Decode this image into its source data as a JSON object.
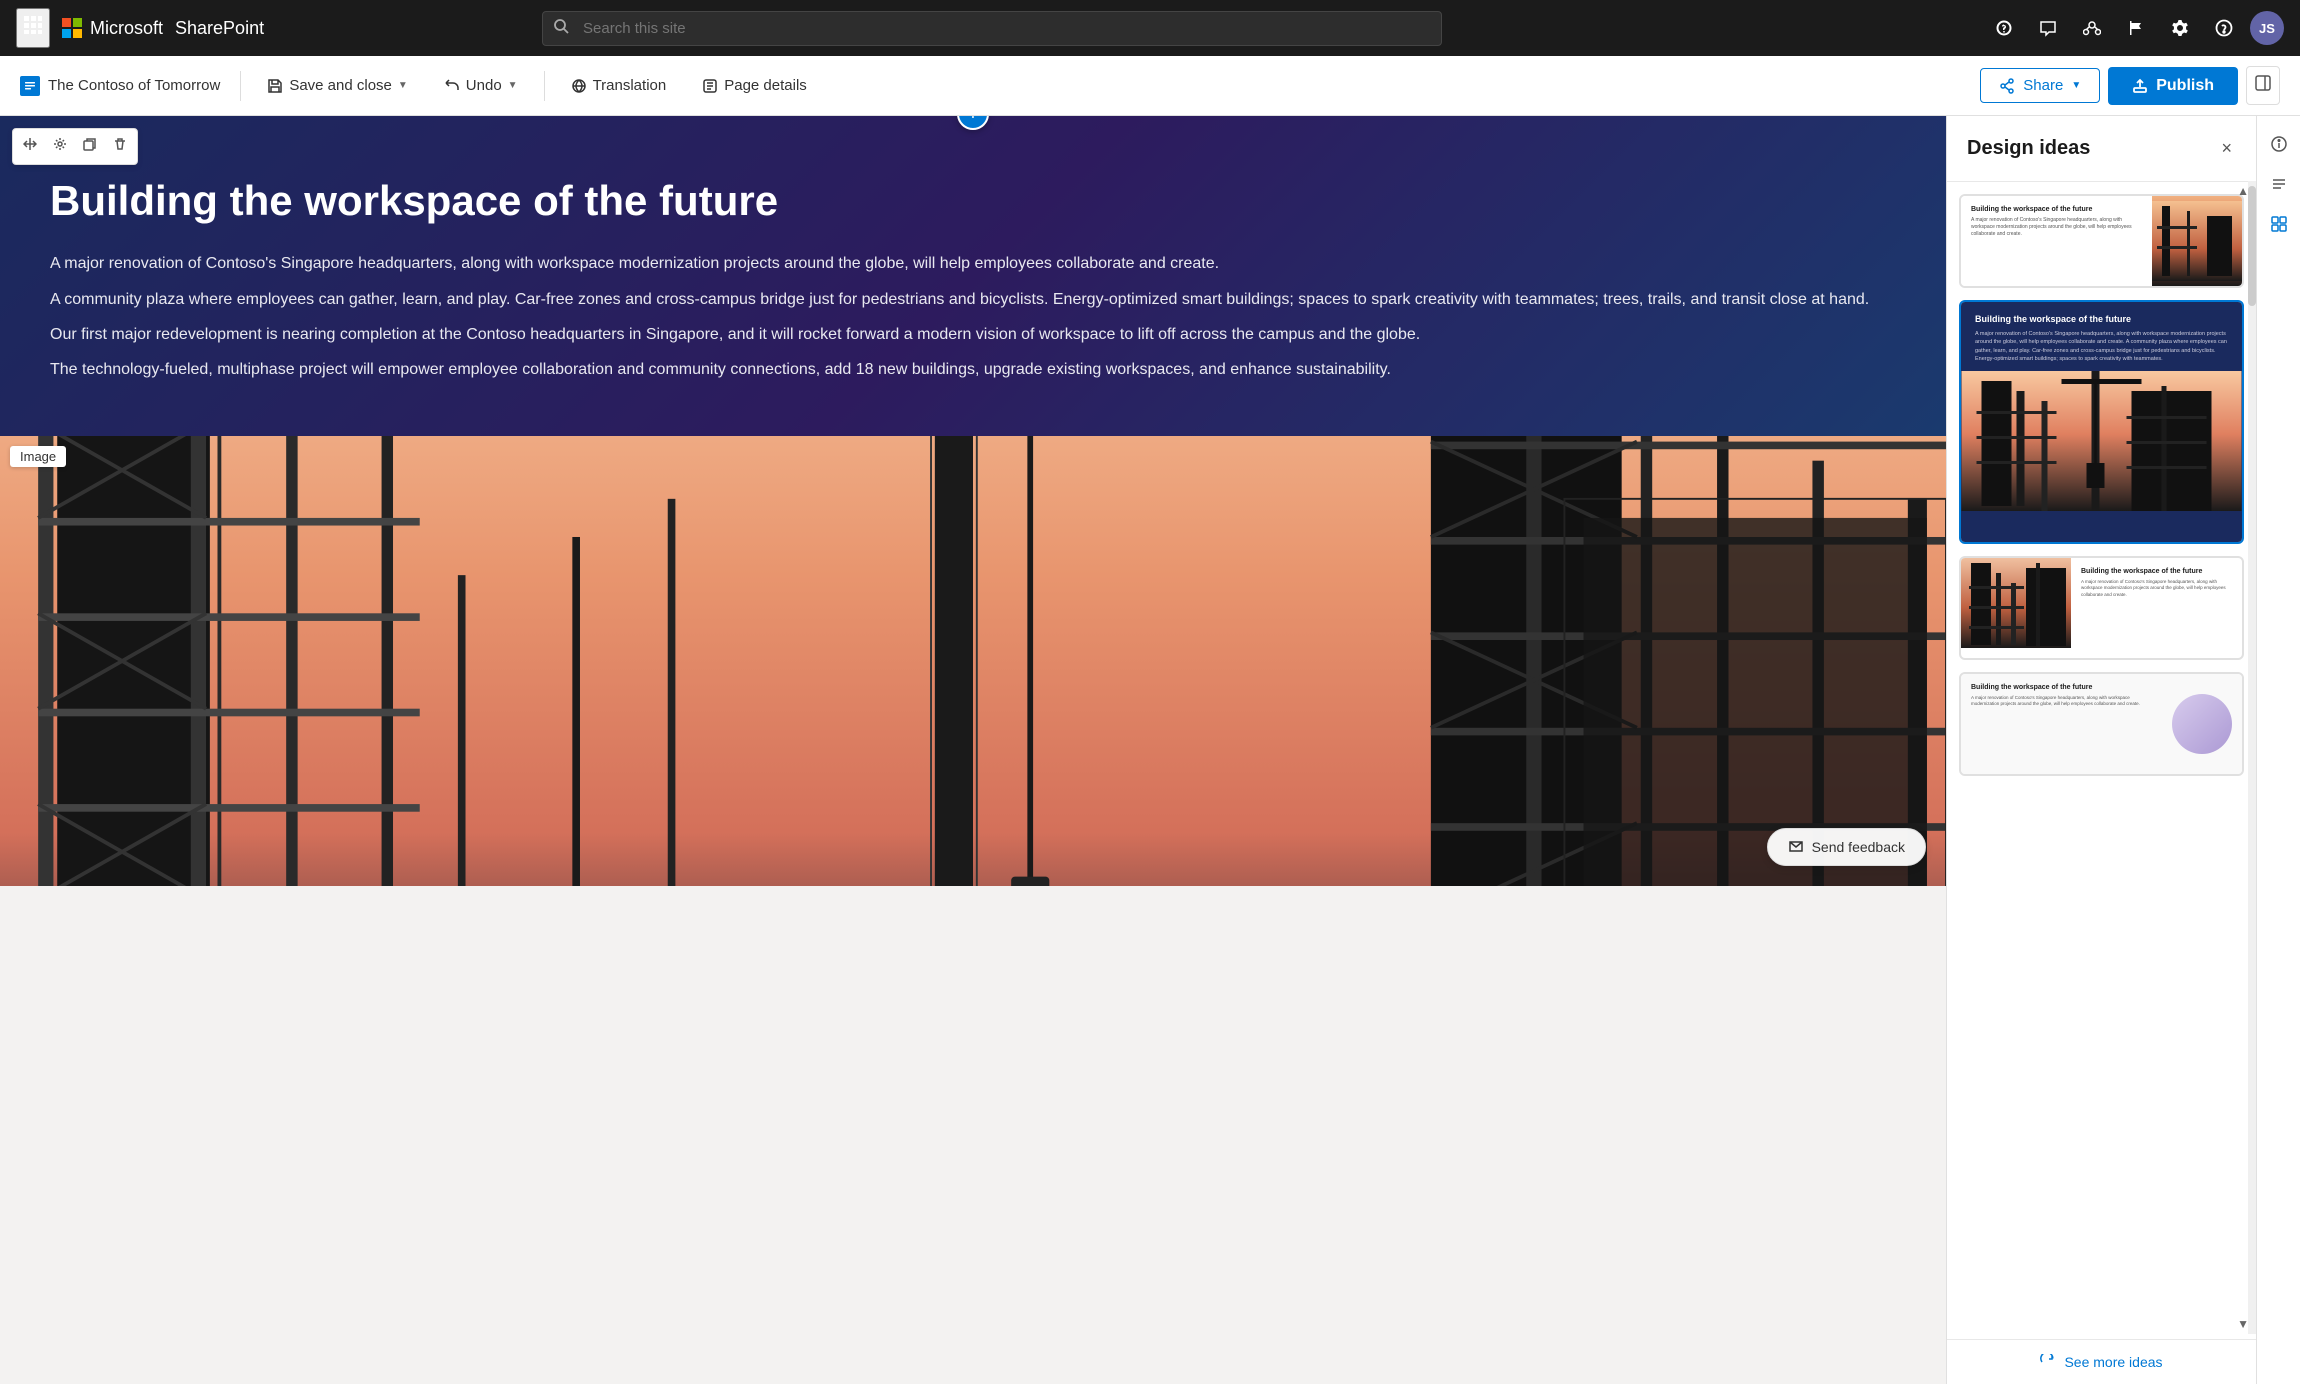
{
  "topnav": {
    "app_name": "Microsoft",
    "app_product": "SharePoint",
    "search_placeholder": "Search this site",
    "icons": [
      "grid-icon",
      "chat-icon",
      "people-icon",
      "flag-icon",
      "settings-icon",
      "help-icon"
    ],
    "avatar_initials": "JS"
  },
  "toolbar": {
    "brand_name": "The Contoso of Tomorrow",
    "save_close_label": "Save and close",
    "undo_label": "Undo",
    "translation_label": "Translation",
    "page_details_label": "Page details",
    "share_label": "Share",
    "publish_label": "Publish"
  },
  "editor": {
    "add_block_symbol": "+",
    "block_controls": [
      "move-icon",
      "settings-icon",
      "duplicate-icon",
      "delete-icon"
    ],
    "hero": {
      "title": "Building the workspace of the future",
      "body_paragraphs": [
        "A major renovation of Contoso's Singapore headquarters, along with workspace modernization projects around the globe, will help employees collaborate and create.",
        "A community plaza where employees can gather, learn, and play. Car-free zones and cross-campus bridge just for pedestrians and bicyclists. Energy-optimized smart buildings; spaces to spark creativity with teammates; trees, trails, and transit close at hand.",
        "Our first major redevelopment is nearing completion at the Contoso headquarters in Singapore, and it will rocket forward a modern vision of workspace to lift off across the campus and the globe.",
        "The technology-fueled, multiphase project will empower employee collaboration and community connections, add 18 new buildings, upgrade existing workspaces, and enhance sustainability."
      ]
    },
    "image_label": "Image",
    "send_feedback_label": "Send feedback"
  },
  "design_panel": {
    "title": "Design ideas",
    "close_icon": "×",
    "see_more_label": "See more ideas",
    "cards": [
      {
        "id": "card-1",
        "selected": false,
        "title_sm": "Building the workspace of the future",
        "body_sm": "A major renovation of Contoso's Singapore headquarters, along with workspace modernization projects around the globe, will help employees collaborate and create."
      },
      {
        "id": "card-2",
        "selected": true,
        "title_sm": "Building the workspace of the future",
        "body_sm": "A major renovation of Contoso's Singapore headquarters, along with workspace modernization projects around the globe, will help employees collaborate and create. A community plaza where employees can gather, learn, and play. Car-free zones and cross-campus bridge just for pedestrians and bicyclists. Energy-optimized smart buildings; spaces to spark creativity with teammates."
      },
      {
        "id": "card-3",
        "selected": false,
        "title_sm": "Building the workspace of the future",
        "body_sm": "A major renovation of Contoso's Singapore headquarters, along with workspace modernization projects around the globe, will help employees collaborate and create."
      },
      {
        "id": "card-4",
        "selected": false,
        "title_sm": "Building the workspace of the future",
        "body_sm": "A major renovation of Contoso's Singapore headquarters, along with workspace modernization projects around the globe, will help employees collaborate and create."
      }
    ]
  }
}
